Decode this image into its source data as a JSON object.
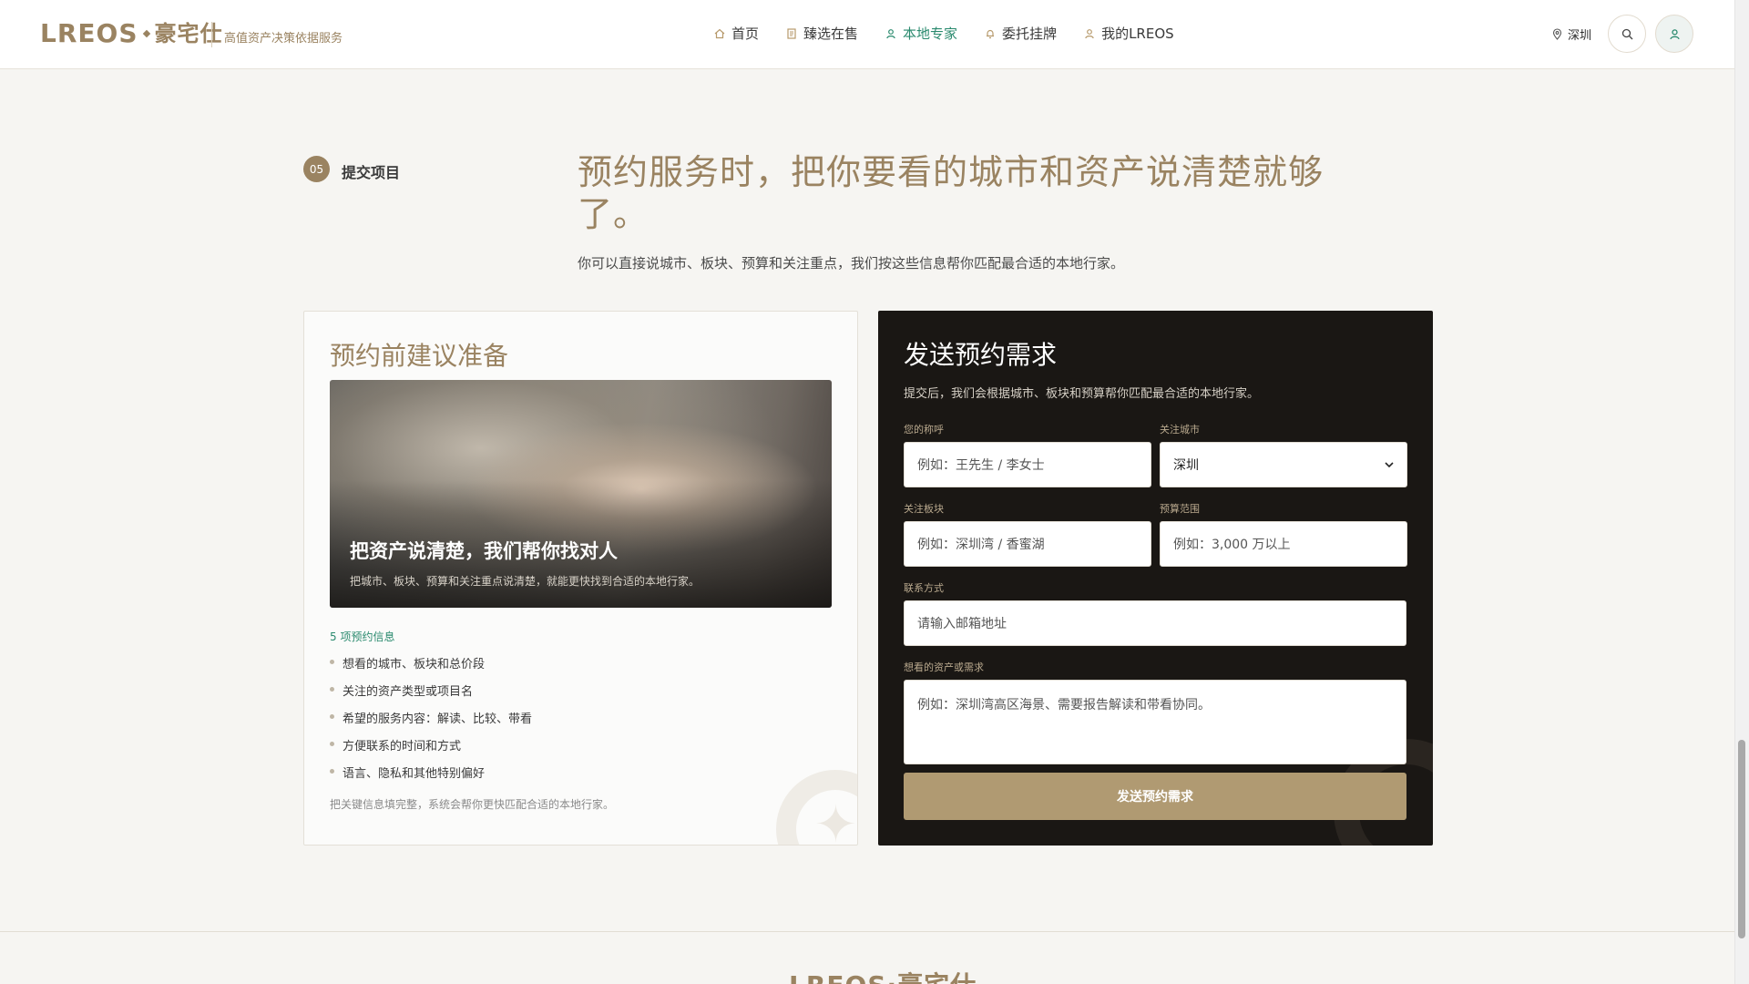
{
  "header": {
    "logo_text": "LREOS",
    "logo_zh": "豪宅仕",
    "tagline": "高值资产决策依据服务",
    "nav": [
      {
        "label": "首页",
        "icon": "home-icon"
      },
      {
        "label": "臻选在售",
        "icon": "document-icon"
      },
      {
        "label": "本地专家",
        "icon": "person-icon",
        "active": true
      },
      {
        "label": "委托挂牌",
        "icon": "bell-icon"
      },
      {
        "label": "我的LREOS",
        "icon": "user-icon"
      }
    ],
    "city": "深圳"
  },
  "section": {
    "step_number": "05",
    "step_label": "提交项目",
    "title": "预约服务时，把你要看的城市和资产说清楚就够了。",
    "subtitle": "你可以直接说城市、板块、预算和关注重点，我们按这些信息帮你匹配最合适的本地行家。"
  },
  "prep_card": {
    "title": "预约前建议准备",
    "hero_title": "把资产说清楚，我们帮你找对人",
    "hero_sub": "把城市、板块、预算和关注重点说清楚，就能更快找到合适的本地行家。",
    "info_head": "5 项预约信息",
    "items": [
      "想看的城市、板块和总价段",
      "关注的资产类型或项目名",
      "希望的服务内容：解读、比较、带看",
      "方便联系的时间和方式",
      "语言、隐私和其他特别偏好"
    ],
    "note": "把关键信息填完整，系统会帮你更快匹配合适的本地行家。"
  },
  "form": {
    "title": "发送预约需求",
    "subtitle": "提交后，我们会根据城市、板块和预算帮你匹配最合适的本地行家。",
    "name_label": "您的称呼",
    "name_placeholder": "例如：王先生 / 李女士",
    "city_label": "关注城市",
    "city_value": "深圳",
    "area_label": "关注板块",
    "area_placeholder": "例如：深圳湾 / 香蜜湖",
    "budget_label": "预算范围",
    "budget_placeholder": "例如：3,000 万以上",
    "contact_label": "联系方式",
    "contact_placeholder": "请输入邮箱地址",
    "needs_label": "想看的资产或需求",
    "needs_placeholder": "例如：深圳湾高区海景、需要报告解读和带看协同。",
    "submit_label": "发送预约需求"
  },
  "footer": {
    "logo_text": "LREOS·豪宅仕"
  },
  "colors": {
    "accent_gold": "#9a8361",
    "active_green": "#2a8a6e",
    "dark_panel": "#1a1714",
    "button_gold": "#b09a72"
  }
}
